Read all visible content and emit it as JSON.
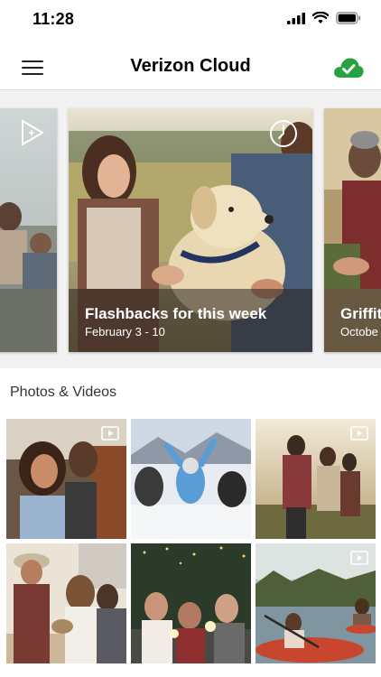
{
  "status_bar": {
    "time": "11:28"
  },
  "header": {
    "title": "Verizon Cloud",
    "sync_color": "#27a243"
  },
  "carousel": {
    "cards": [
      {
        "title": "",
        "subtitle": "",
        "icon": "play-sparkle-icon"
      },
      {
        "title": "Flashbacks for this week",
        "subtitle": "February 3 - 10",
        "icon": "clock-icon"
      },
      {
        "title": "Griffit",
        "subtitle": "Octobe",
        "icon": ""
      }
    ]
  },
  "photos": {
    "section_title": "Photos & Videos",
    "items": [
      {
        "kind": "video",
        "scene": "couple-van"
      },
      {
        "kind": "photo",
        "scene": "friends-snow"
      },
      {
        "kind": "video",
        "scene": "hikers-field"
      },
      {
        "kind": "photo",
        "scene": "couple-beach"
      },
      {
        "kind": "photo",
        "scene": "friends-sparklers"
      },
      {
        "kind": "video",
        "scene": "kayaking-lake"
      }
    ]
  }
}
